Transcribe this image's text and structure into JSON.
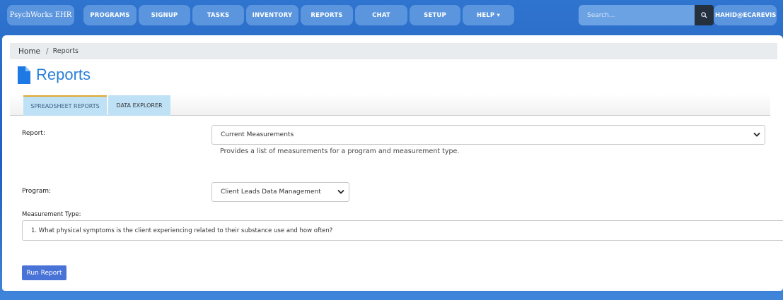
{
  "nav": {
    "brand": "PsychWorks EHR",
    "items": [
      "PROGRAMS",
      "SIGNUP",
      "TASKS",
      "INVENTORY",
      "REPORTS",
      "CHAT",
      "SETUP",
      "HELP ▾"
    ],
    "search_placeholder": "Search...",
    "search_icon": "search-icon",
    "user": "HAHID@ECAREVISIO"
  },
  "breadcrumb": {
    "home": "Home",
    "separator": "/",
    "current": "Reports"
  },
  "page": {
    "title": "Reports",
    "title_icon": "document-icon"
  },
  "tabs": [
    "SPREADSHEET REPORTS",
    "DATA EXPLORER"
  ],
  "form": {
    "report_label": "Report:",
    "report_value": "Current Measurements",
    "report_help": "Provides a list of measurements for a program and measurement type.",
    "program_label": "Program:",
    "program_value": "Client Leads Data Management",
    "measurement_label": "Measurement Type:",
    "measurement_value": "1. What physical symptoms is the client experiencing related to their substance use and how often?",
    "run_button": "Run Report"
  },
  "colors": {
    "background": "#2f74cf",
    "nav_button": "#5b95dd",
    "title": "#2a7fd9",
    "tab": "#bfe1f6",
    "tab_active_border": "#e0a82e",
    "run_button": "#4a73d8"
  }
}
